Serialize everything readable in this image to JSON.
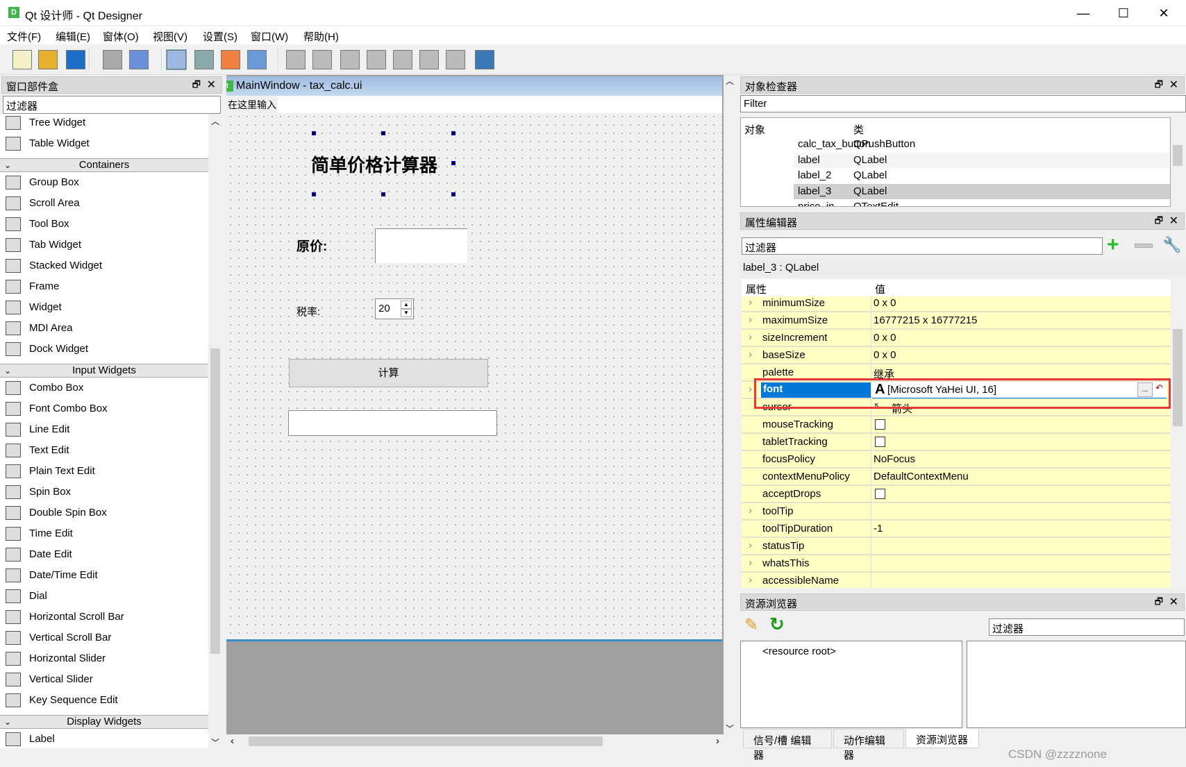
{
  "window": {
    "title": "Qt 设计师 - Qt Designer",
    "app_icon": "D",
    "minimize": "—",
    "maximize": "☐",
    "close": "✕"
  },
  "menu": [
    "文件(F)",
    "编辑(E)",
    "窗体(O)",
    "视图(V)",
    "设置(S)",
    "窗口(W)",
    "帮助(H)"
  ],
  "toolbar": [
    "new-file",
    "open-file",
    "save-file",
    "send-to-back",
    "bring-to-front",
    "edit-widgets",
    "edit-signals-slots",
    "edit-buddies",
    "edit-tab-order",
    "layout-horizontal",
    "layout-vertical",
    "layout-horizontal-splitter",
    "layout-vertical-splitter",
    "layout-grid",
    "layout-form",
    "break-layout",
    "adjust-size"
  ],
  "widget_box": {
    "title": "窗口部件盒",
    "filter_placeholder": "过滤器",
    "entries": [
      {
        "label": "Tree Widget"
      },
      {
        "label": "Table Widget"
      },
      {
        "section": "Containers"
      },
      {
        "label": "Group Box"
      },
      {
        "label": "Scroll Area"
      },
      {
        "label": "Tool Box"
      },
      {
        "label": "Tab Widget"
      },
      {
        "label": "Stacked Widget"
      },
      {
        "label": "Frame"
      },
      {
        "label": "Widget"
      },
      {
        "label": "MDI Area"
      },
      {
        "label": "Dock Widget"
      },
      {
        "section": "Input Widgets"
      },
      {
        "label": "Combo Box"
      },
      {
        "label": "Font Combo Box"
      },
      {
        "label": "Line Edit"
      },
      {
        "label": "Text Edit"
      },
      {
        "label": "Plain Text Edit"
      },
      {
        "label": "Spin Box"
      },
      {
        "label": "Double Spin Box"
      },
      {
        "label": "Time Edit"
      },
      {
        "label": "Date Edit"
      },
      {
        "label": "Date/Time Edit"
      },
      {
        "label": "Dial"
      },
      {
        "label": "Horizontal Scroll Bar"
      },
      {
        "label": "Vertical Scroll Bar"
      },
      {
        "label": "Horizontal Slider"
      },
      {
        "label": "Vertical Slider"
      },
      {
        "label": "Key Sequence Edit"
      },
      {
        "section": "Display Widgets"
      },
      {
        "label": "Label"
      }
    ]
  },
  "form": {
    "title": "MainWindow - tax_calc.ui",
    "menu_placeholder": "在这里输入",
    "heading": "简单价格计算器",
    "price_label": "原价:",
    "price_value": "",
    "tax_label": "税率:",
    "tax_value": "20",
    "calc_button": "计算",
    "result_value": ""
  },
  "object_inspector": {
    "title": "对象检查器",
    "filter_placeholder": "Filter",
    "col_object": "对象",
    "col_class": "类",
    "rows": [
      {
        "object": "calc_tax_button",
        "class": "QPushButton"
      },
      {
        "object": "label",
        "class": "QLabel"
      },
      {
        "object": "label_2",
        "class": "QLabel"
      },
      {
        "object": "label_3",
        "class": "QLabel",
        "selected": true
      },
      {
        "object": "price_in",
        "class": "QTextEdit"
      }
    ]
  },
  "property_editor": {
    "title": "属性编辑器",
    "filter_placeholder": "过滤器",
    "object_title": "label_3 : QLabel",
    "col_property": "属性",
    "col_value": "值",
    "rows": [
      {
        "name": "minimumSize",
        "value": "0 x 0",
        "expand": true
      },
      {
        "name": "maximumSize",
        "value": "16777215 x 16777215",
        "expand": true
      },
      {
        "name": "sizeIncrement",
        "value": "0 x 0",
        "expand": true
      },
      {
        "name": "baseSize",
        "value": "0 x 0",
        "expand": true
      },
      {
        "name": "palette",
        "value": "继承"
      },
      {
        "name": "font",
        "value": "[Microsoft YaHei UI, 16]",
        "expand": true,
        "selected": true
      },
      {
        "name": "cursor",
        "value": "箭头"
      },
      {
        "name": "mouseTracking",
        "checkbox": false
      },
      {
        "name": "tabletTracking",
        "checkbox": false
      },
      {
        "name": "focusPolicy",
        "value": "NoFocus"
      },
      {
        "name": "contextMenuPolicy",
        "value": "DefaultContextMenu"
      },
      {
        "name": "acceptDrops",
        "checkbox": false
      },
      {
        "name": "toolTip",
        "value": "",
        "expand": true
      },
      {
        "name": "toolTipDuration",
        "value": "-1"
      },
      {
        "name": "statusTip",
        "value": "",
        "expand": true
      },
      {
        "name": "whatsThis",
        "value": "",
        "expand": true
      },
      {
        "name": "accessibleName",
        "value": "",
        "expand": true
      }
    ],
    "font_edit_button": "...",
    "font_reset": "↶",
    "highlight_color": "#e53935"
  },
  "resource_browser": {
    "title": "资源浏览器",
    "filter_placeholder": "过滤器",
    "root": "<resource root>"
  },
  "bottom_tabs": [
    "信号/槽 编辑器",
    "动作编辑器",
    "资源浏览器"
  ],
  "watermark": "CSDN @zzzznone",
  "colors": {
    "selection": "#0078d7",
    "property_bg": "#ffffc4",
    "form_title": "#9dbbe0"
  }
}
